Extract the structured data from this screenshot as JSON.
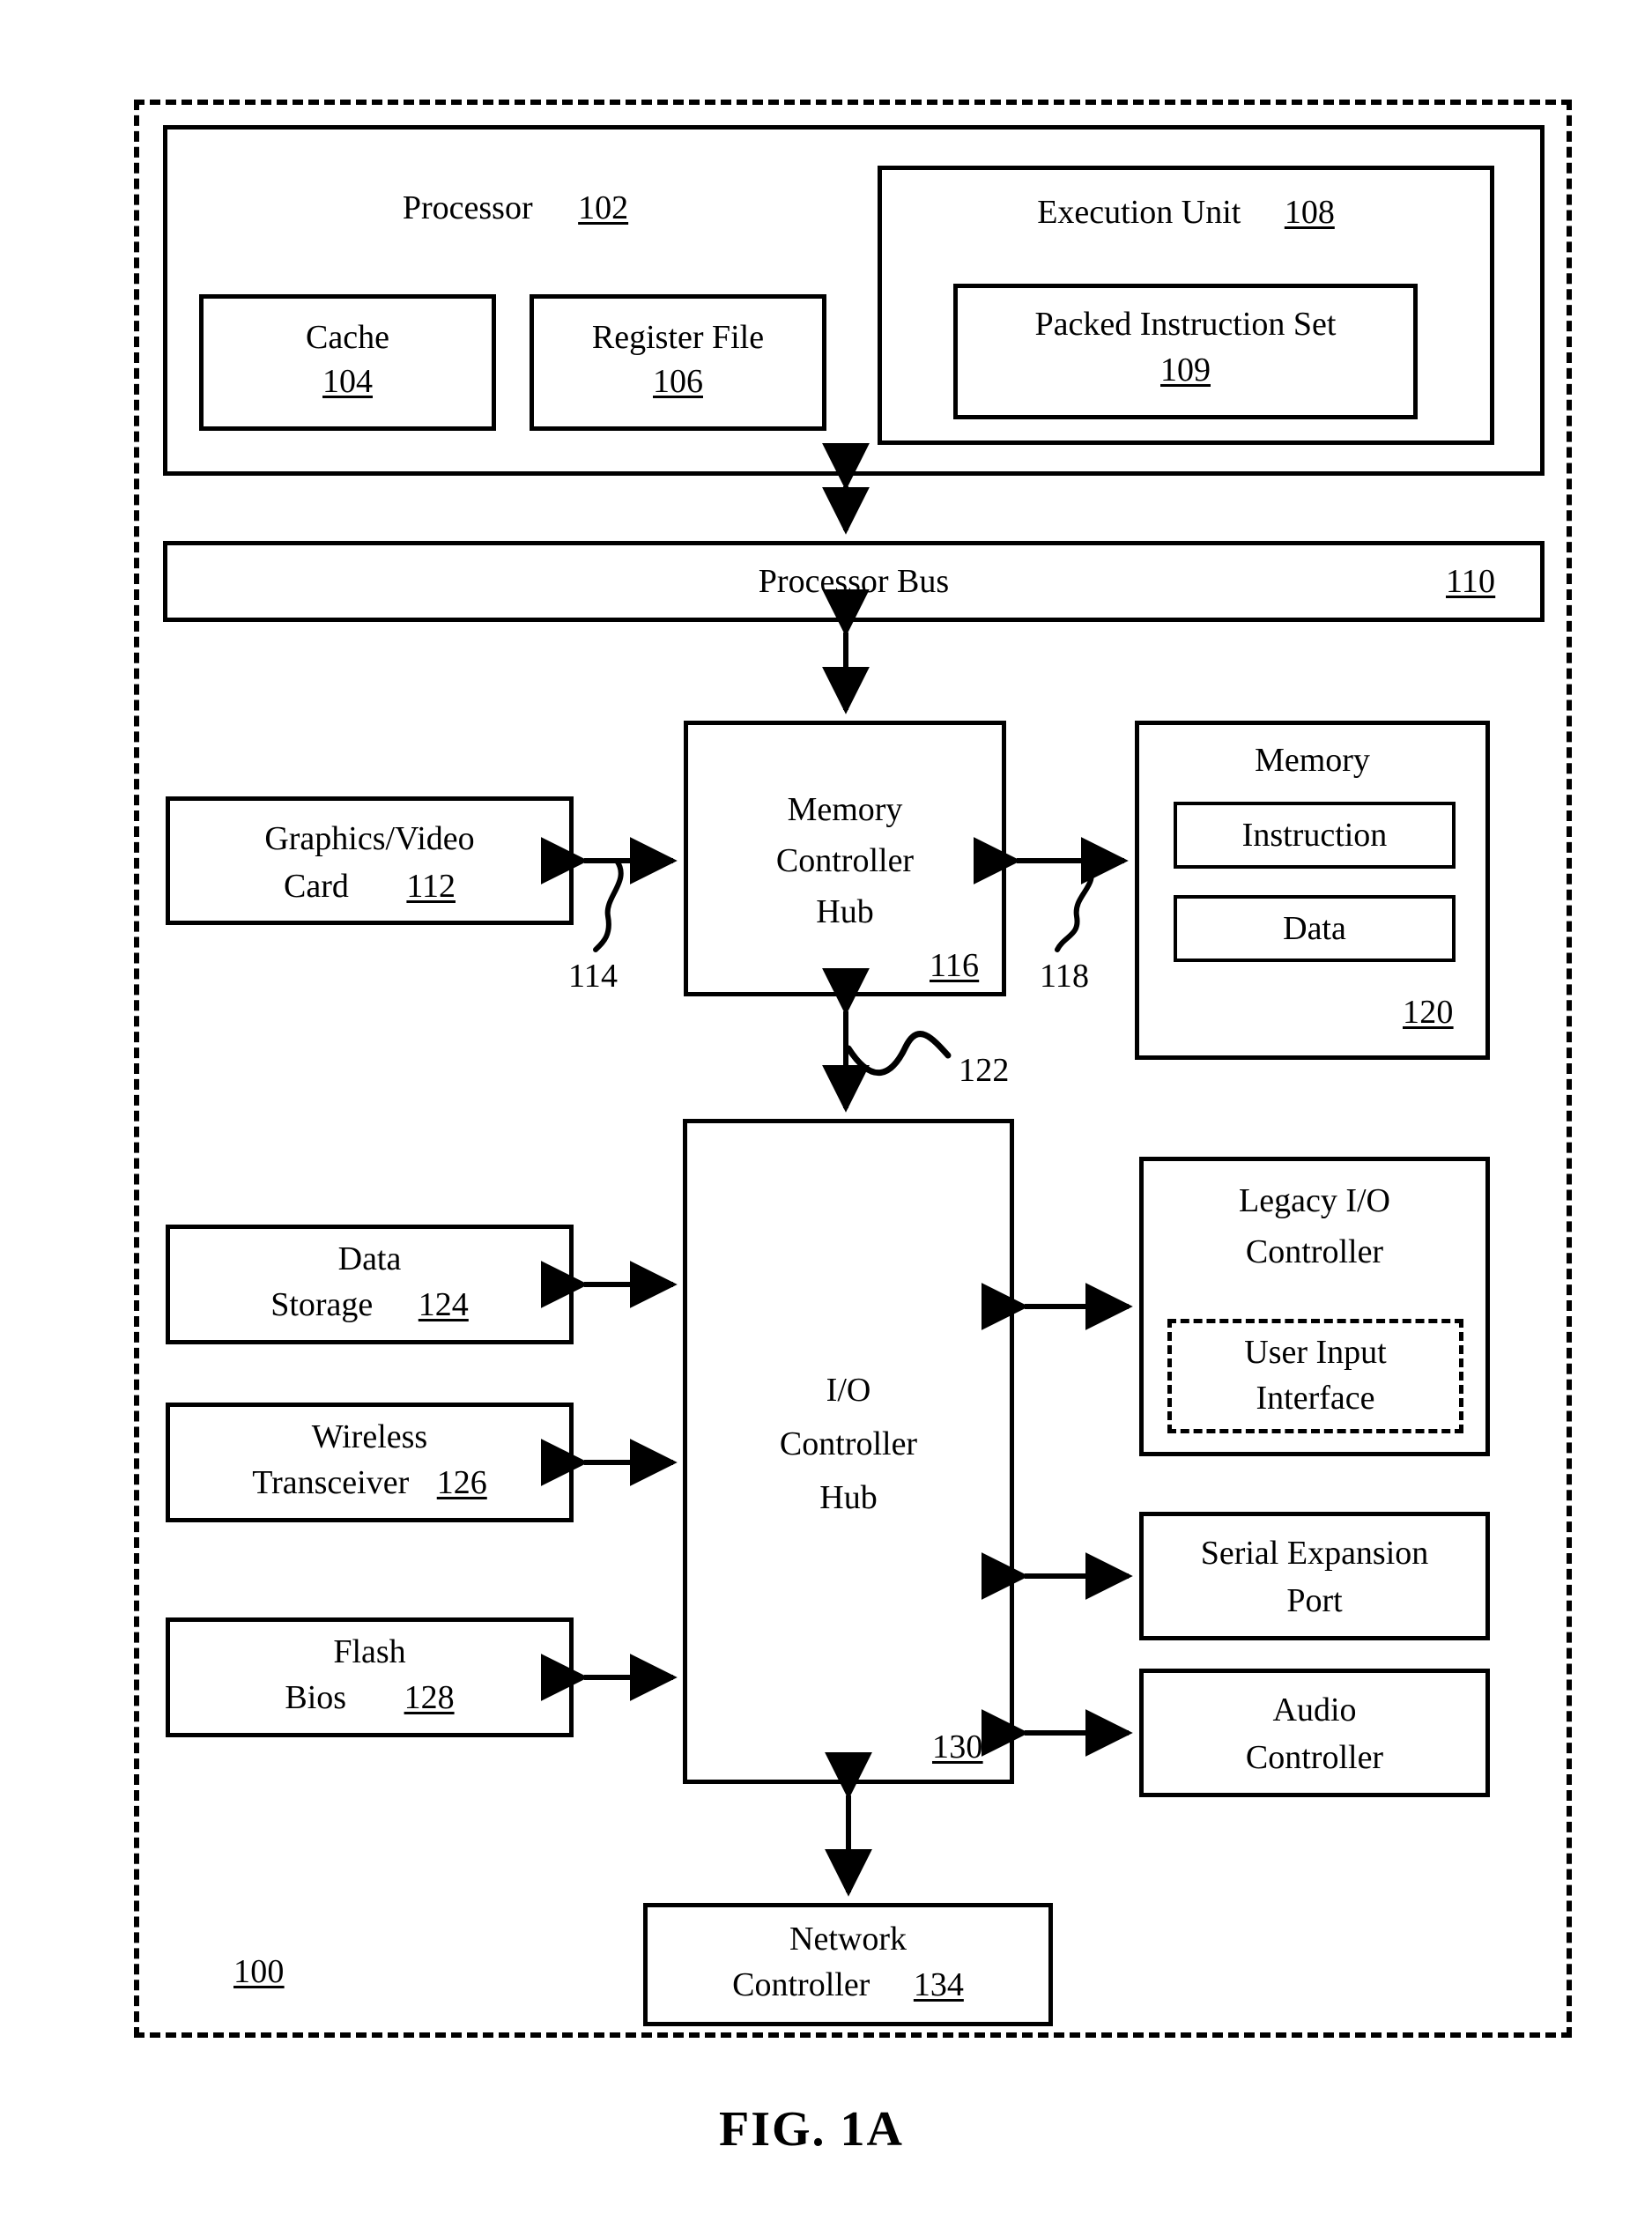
{
  "figure": {
    "caption": "FIG. 1A",
    "system_ref": "100"
  },
  "processor": {
    "title": "Processor",
    "ref": "102",
    "cache": {
      "title": "Cache",
      "ref": "104"
    },
    "register_file": {
      "title": "Register File",
      "ref": "106"
    },
    "execution_unit": {
      "title": "Execution Unit",
      "ref": "108",
      "packed_instruction_set": {
        "title": "Packed Instruction Set",
        "ref": "109"
      }
    }
  },
  "processor_bus": {
    "title": "Processor Bus",
    "ref": "110"
  },
  "graphics_card": {
    "line1": "Graphics/Video",
    "line2": "Card",
    "ref": "112"
  },
  "memory_controller_hub": {
    "line1": "Memory",
    "line2": "Controller",
    "line3": "Hub",
    "ref": "116"
  },
  "memory": {
    "title": "Memory",
    "ref": "120",
    "instruction": "Instruction",
    "data": "Data"
  },
  "io_controller_hub": {
    "line1": "I/O",
    "line2": "Controller",
    "line3": "Hub",
    "ref": "130"
  },
  "data_storage": {
    "line1": "Data",
    "line2": "Storage",
    "ref": "124"
  },
  "wireless_transceiver": {
    "line1": "Wireless",
    "line2": "Transceiver",
    "ref": "126"
  },
  "flash_bios": {
    "line1": "Flash",
    "line2": "Bios",
    "ref": "128"
  },
  "legacy_io_controller": {
    "line1": "Legacy I/O",
    "line2": "Controller",
    "user_input_interface": {
      "line1": "User Input",
      "line2": "Interface"
    }
  },
  "serial_expansion_port": {
    "line1": "Serial Expansion",
    "line2": "Port"
  },
  "audio_controller": {
    "line1": "Audio",
    "line2": "Controller"
  },
  "network_controller": {
    "line1": "Network",
    "line2": "Controller",
    "ref": "134"
  },
  "connector_labels": {
    "graphics_link": "114",
    "memory_link": "118",
    "hub_interface": "122"
  },
  "colors": {
    "line": "#000000",
    "background": "#ffffff"
  }
}
